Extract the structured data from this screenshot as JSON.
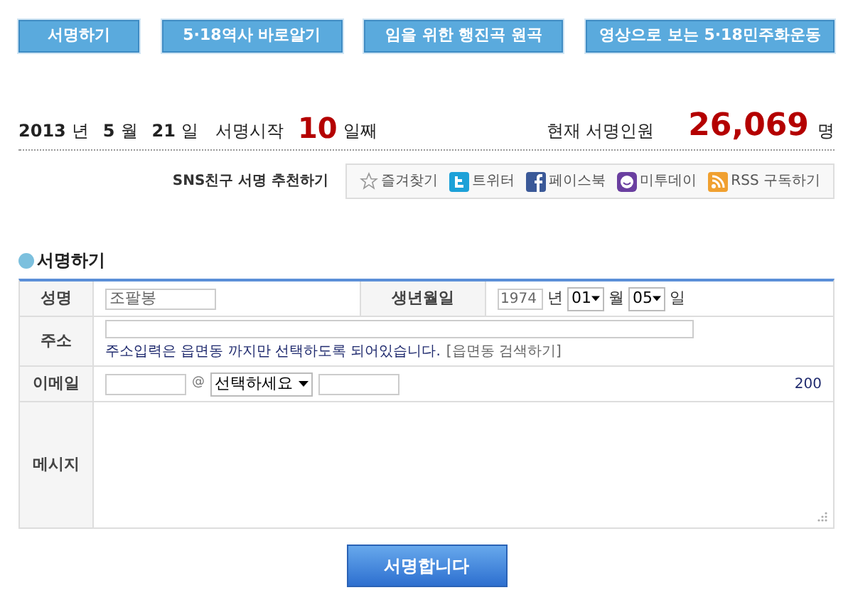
{
  "nav_buttons": [
    "서명하기",
    "5·18역사 바로알기",
    "임을 위한 행진곡 원곡",
    "영상으로 보는 5·18민주화운동"
  ],
  "stats": {
    "year": "2013",
    "year_unit": "년",
    "month": "5",
    "month_unit": "월",
    "day": "21",
    "day_unit": "일",
    "start_label": "서명시작",
    "days": "10",
    "days_unit": "일째",
    "count_label": "현재 서명인원",
    "count": "26,069",
    "count_unit": "명"
  },
  "sns": {
    "label": "SNS친구 서명 추천하기",
    "links": [
      {
        "kind": "star",
        "label": "즐겨찾기"
      },
      {
        "kind": "twitter",
        "label": "트위터"
      },
      {
        "kind": "facebook",
        "label": "페이스북"
      },
      {
        "kind": "me2day",
        "label": "미투데이"
      },
      {
        "kind": "rss",
        "label": "RSS 구독하기"
      }
    ]
  },
  "section_title": "서명하기",
  "form": {
    "name_label": "성명",
    "name_value": "조팔봉",
    "birth_label": "생년월일",
    "birth_year": "1974",
    "year_unit": "년",
    "birth_month": "01",
    "month_unit": "월",
    "birth_day": "05",
    "day_unit": "일",
    "address_label": "주소",
    "address_note": "주소입력은 읍면동 까지만 선택하도록 되어있습니다.",
    "address_search": "[읍면동 검색하기]",
    "email_label": "이메일",
    "at": "@",
    "domain_select": "선택하세요",
    "char_limit": "200",
    "message_label": "메시지"
  },
  "submit": "서명합니다"
}
